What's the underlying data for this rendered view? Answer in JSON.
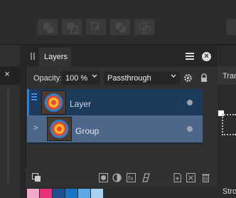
{
  "layers_panel": {
    "title": "Layers",
    "opacity_label": "Opacity:",
    "opacity_value": "100 %",
    "blend_mode": "Passthrough"
  },
  "layers": [
    {
      "name": "Layer",
      "type": "pixel-layer",
      "selected": true
    },
    {
      "name": "Group",
      "type": "group",
      "expanded": false
    }
  ],
  "right_panel": {
    "tab_label": "Tran",
    "stroke_label": "Stro"
  },
  "left_panel": {
    "close_glyph": "×"
  },
  "icons": {
    "panel_menu": "hamburger-icon",
    "panel_close": "close-icon",
    "settings": "gear-icon",
    "lock": "lock-icon"
  },
  "colors": {
    "accent": "#2d7fd2",
    "selected_row": "#4d6689",
    "active_row": "#1c3a5c",
    "swatches": [
      "#f4a9c9",
      "#e9317c",
      "#1f4f8a",
      "#1a73c5",
      "#5aa9e6",
      "#a9d1f2"
    ]
  }
}
